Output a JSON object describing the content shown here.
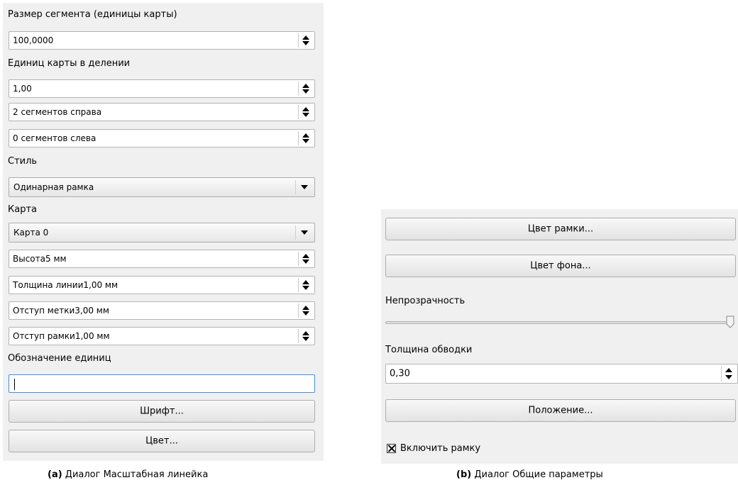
{
  "dialog_a": {
    "segment_size_label": "Размер сегмента (единицы карты)",
    "segment_size_value": "100,0000",
    "units_per_division_label": "Единиц карты в делении",
    "units_per_division_value": "1,00",
    "segments_right_value": "2 сегментов справа",
    "segments_left_value": "0 сегментов слева",
    "style_label": "Стиль",
    "style_value": "Одинарная рамка",
    "map_label": "Карта",
    "map_value": "Карта 0",
    "height_value": "Высота5 мм",
    "line_width_value": "Толщина линии1,00 мм",
    "label_offset_value": "Отступ метки3,00 мм",
    "box_margin_value": "Отступ рамки1,00 мм",
    "unit_label_label": "Обозначение единиц",
    "unit_label_value": "",
    "font_button": "Шрифт...",
    "color_button": "Цвет..."
  },
  "dialog_b": {
    "frame_color_button": "Цвет рамки...",
    "background_color_button": "Цвет фона...",
    "opacity_label": "Непрозрачность",
    "opacity_value": 1.0,
    "outline_width_label": "Толщина обводки",
    "outline_width_value": "0,30",
    "position_button": "Положение...",
    "enable_frame_label": "Включить рамку",
    "enable_frame_checked": true
  },
  "captions": {
    "a_tag": "(a)",
    "a_text": " Диалог Масштабная линейка",
    "b_tag": "(b)",
    "b_text": " Диалог Общие параметры"
  }
}
